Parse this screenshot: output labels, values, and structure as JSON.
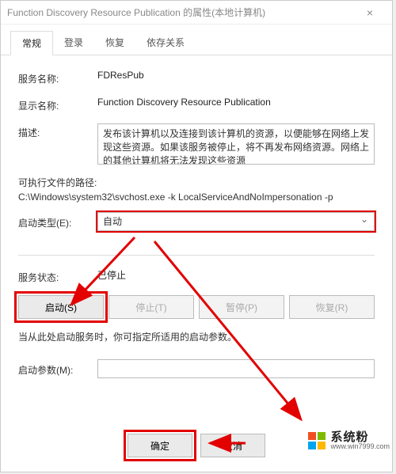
{
  "window": {
    "title": "Function Discovery Resource Publication 的属性(本地计算机)",
    "close_glyph": "×"
  },
  "tabs": {
    "general": "常规",
    "logon": "登录",
    "recovery": "恢复",
    "dependencies": "依存关系"
  },
  "labels": {
    "service_name": "服务名称:",
    "display_name": "显示名称:",
    "description": "描述:",
    "exe_path": "可执行文件的路径:",
    "startup_type": "启动类型(E):",
    "service_state": "服务状态:",
    "start_param": "启动参数(M):",
    "hint": "当从此处启动服务时，你可指定所适用的启动参数。"
  },
  "values": {
    "service_name": "FDResPub",
    "display_name": "Function Discovery Resource Publication",
    "description": "发布该计算机以及连接到该计算机的资源，以便能够在网络上发现这些资源。如果该服务被停止，将不再发布网络资源。网络上的其他计算机将无法发现这些资源",
    "exe_path": "C:\\Windows\\system32\\svchost.exe -k LocalServiceAndNoImpersonation -p",
    "startup_type": "自动",
    "service_state": "已停止",
    "start_param": ""
  },
  "buttons": {
    "start": "启动(S)",
    "stop": "停止(T)",
    "pause": "暂停(P)",
    "resume": "恢复(R)",
    "ok": "确定",
    "cancel": "取消"
  },
  "watermark": {
    "line1": "系统粉",
    "line2": "www.win7999.com"
  }
}
